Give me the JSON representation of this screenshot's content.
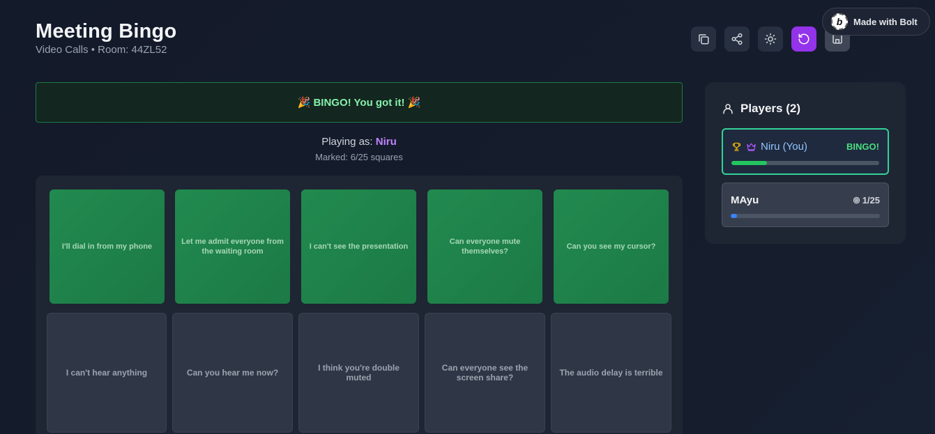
{
  "header": {
    "title": "Meeting Bingo",
    "subtitle": "Video Calls • Room: 44ZL52"
  },
  "toolbar": {
    "buttons": [
      {
        "name": "copy-icon"
      },
      {
        "name": "share-icon"
      },
      {
        "name": "sun-icon"
      },
      {
        "name": "refresh-icon"
      },
      {
        "name": "leaderboard-icon"
      }
    ]
  },
  "bolt_badge": {
    "label": "Made with Bolt",
    "logo_letter": "b"
  },
  "banner": {
    "text": "🎉 BINGO! You got it! 🎉"
  },
  "status": {
    "playing_prefix": "Playing as:",
    "player_name": "Niru",
    "marked_text": "Marked: 6/25 squares"
  },
  "board": {
    "rows": [
      [
        {
          "text": "I'll dial in from my phone",
          "marked": true
        },
        {
          "text": "Let me admit everyone from the waiting room",
          "marked": true
        },
        {
          "text": "I can't see the presentation",
          "marked": true
        },
        {
          "text": "Can everyone mute themselves?",
          "marked": true
        },
        {
          "text": "Can you see my cursor?",
          "marked": true
        }
      ],
      [
        {
          "text": "I can't hear anything",
          "marked": false
        },
        {
          "text": "Can you hear me now?",
          "marked": false
        },
        {
          "text": "I think you're double muted",
          "marked": false
        },
        {
          "text": "Can everyone see the screen share?",
          "marked": false
        },
        {
          "text": "The audio delay is terrible",
          "marked": false
        }
      ]
    ]
  },
  "players": {
    "title": "Players (2)",
    "list": [
      {
        "name": "Niru (You)",
        "status": "BINGO!",
        "progress": 0.24,
        "is_me": true
      },
      {
        "name": "MAyu",
        "score": "1/25",
        "progress": 0.04,
        "is_me": false
      }
    ]
  },
  "colors": {
    "accent_purple": "#9333ea",
    "marked_green": "#218a4f",
    "bingo_green": "#4ade80",
    "progress_blue": "#3b82f6"
  }
}
